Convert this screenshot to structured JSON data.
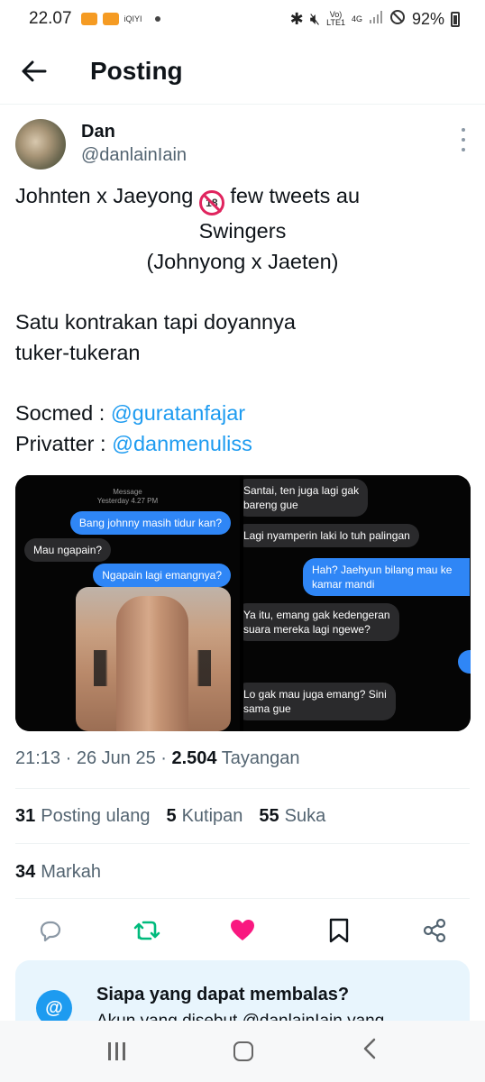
{
  "status_bar": {
    "time": "22.07",
    "app_label": "iQIYI",
    "network_top": "Vo)",
    "network_bottom": "LTE1",
    "signal_type": "4G",
    "battery": "92%"
  },
  "header": {
    "title": "Posting"
  },
  "author": {
    "name": "Dan",
    "handle": "@danlainIain"
  },
  "tweet": {
    "line1_before": "Johnten x Jaeyong",
    "line1_after": "few tweets au",
    "line2": "Swingers",
    "line3": "(Johnyong x Jaeten)",
    "para2_line1": "Satu kontrakan tapi doyannya",
    "para2_line2": "tuker-tukeran",
    "socmed_label": "Socmed :",
    "socmed_link": "@guratanfajar",
    "privatter_label": "Privatter :",
    "privatter_link": "@danmenuliss",
    "badge": "18"
  },
  "media": {
    "left": {
      "header_line1": "Message",
      "header_line2": "Yesterday 4.27 PM",
      "bubbles": [
        "Bang johnny masih tidur kan?",
        "Mau ngapain?",
        "Ngapain lagi emangnya?"
      ]
    },
    "right": {
      "bubbles": [
        "Santai, ten juga lagi gak",
        "bareng gue",
        "Lagi nyamperin laki lo tuh palingan",
        "Hah? Jaehyun bilang mau ke",
        "kamar mandi",
        "Ya itu, emang gak kedengeran",
        "suara mereka lagi ngewe?",
        "Lo gak mau juga emang? Sini",
        "sama gue"
      ]
    }
  },
  "meta": {
    "time": "21:13",
    "date": "26 Jun 25",
    "views": "2.504",
    "views_label": "Tayangan"
  },
  "stats": {
    "reposts": "31",
    "reposts_label": "Posting ulang",
    "quotes": "5",
    "quotes_label": "Kutipan",
    "likes": "55",
    "likes_label": "Suka",
    "bookmarks": "34",
    "bookmarks_label": "Markah"
  },
  "reply_card": {
    "title": "Siapa yang dapat membalas?",
    "subtitle": "Akun yang disebut @danlainIain yang"
  },
  "colors": {
    "accent": "#1d9bf0",
    "retweet": "#00ba7c",
    "like": "#f91880",
    "muted": "#536471"
  }
}
